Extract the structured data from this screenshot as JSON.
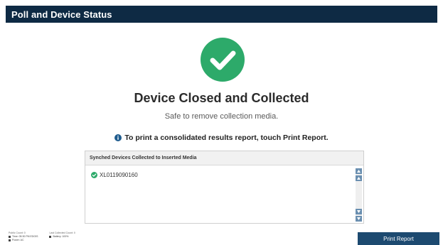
{
  "header": {
    "title": "Poll and Device Status"
  },
  "status": {
    "icon": "check-circle-icon",
    "title": "Device Closed and Collected",
    "subtitle": "Safe to remove collection media.",
    "info_icon": "info-icon",
    "info_text": "To print a consolidated results report, touch Print Report."
  },
  "panel": {
    "title": "Synched Devices Collected to Inserted Media",
    "items": [
      {
        "label": "XL0119090160",
        "icon": "check-circle-icon"
      }
    ]
  },
  "footer": {
    "col1": {
      "label": "Public Count: 0",
      "time": "Time: 05:30 PM EDOIS",
      "power": "Power: AC"
    },
    "col2": {
      "label": "Last Collected Count: 0",
      "battery": "Battery: 100%"
    }
  },
  "actions": {
    "print_label": "Print Report"
  },
  "colors": {
    "header_bg": "#0e2a44",
    "success": "#2daa6a",
    "info": "#1f5c8e",
    "button_bg": "#1d4a70",
    "scroll_btn": "#6a8fb0"
  }
}
